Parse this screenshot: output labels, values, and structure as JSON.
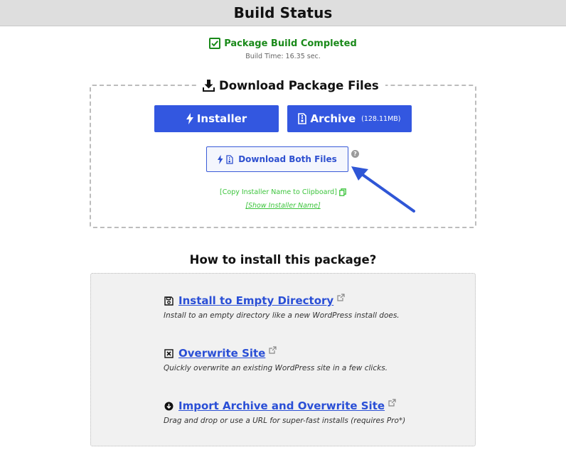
{
  "header": {
    "title": "Build Status"
  },
  "status": {
    "text": "Package Build Completed",
    "build_time": "Build Time: 16.35 sec.",
    "color": "#1a8a1a"
  },
  "download": {
    "title": "Download Package Files",
    "installer_label": "Installer",
    "archive_label": "Archive",
    "archive_size": "(128.11MB)",
    "both_label": "Download Both Files",
    "copy_link": "[Copy Installer Name to Clipboard]",
    "show_link": "[Show Installer Name]",
    "accent": "#3357e0",
    "link_color": "#3cc43c"
  },
  "how": {
    "title": "How to install this package?",
    "options": [
      {
        "label": "Install to Empty Directory",
        "icon": "floppy-disk-icon",
        "desc": "Install to an empty directory like a new WordPress install does."
      },
      {
        "label": "Overwrite Site",
        "icon": "square-x-icon",
        "desc": "Quickly overwrite an existing WordPress site in a few clicks."
      },
      {
        "label": "Import Archive and Overwrite Site",
        "icon": "circle-download-icon",
        "desc": "Drag and drop or use a URL for super-fast installs (requires Pro*)"
      }
    ]
  }
}
